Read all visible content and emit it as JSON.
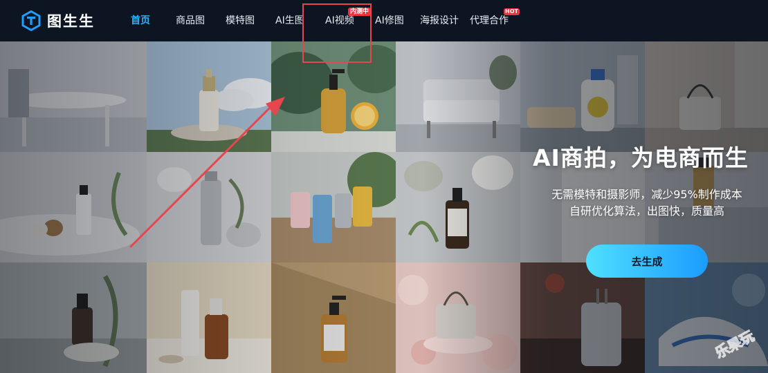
{
  "brand": {
    "name": "图生生"
  },
  "nav": {
    "items": [
      {
        "label": "首页",
        "active": true
      },
      {
        "label": "商品图"
      },
      {
        "label": "模特图"
      },
      {
        "label": "AI生图"
      },
      {
        "label": "AI视频",
        "badge": "内测中"
      },
      {
        "label": "AI修图"
      },
      {
        "label": "海报设计"
      },
      {
        "label": "代理合作",
        "badge": "HOT"
      }
    ]
  },
  "hero": {
    "title": "AI商拍，为电商而生",
    "subtitle_line1": "无需模特和摄影师，减少95%制作成本",
    "subtitle_line2": "自研优化算法，出图快，质量高",
    "cta_label": "去生成"
  },
  "colors": {
    "nav_bg": "#0d1522",
    "active": "#27b4ff",
    "badge": "#f0323c",
    "cta_start": "#4fe0ff",
    "cta_end": "#1b9cff",
    "annotation": "#e8464e"
  },
  "icons": {
    "logo": "t-logo-icon",
    "annotation_arrow": "arrow-icon"
  }
}
